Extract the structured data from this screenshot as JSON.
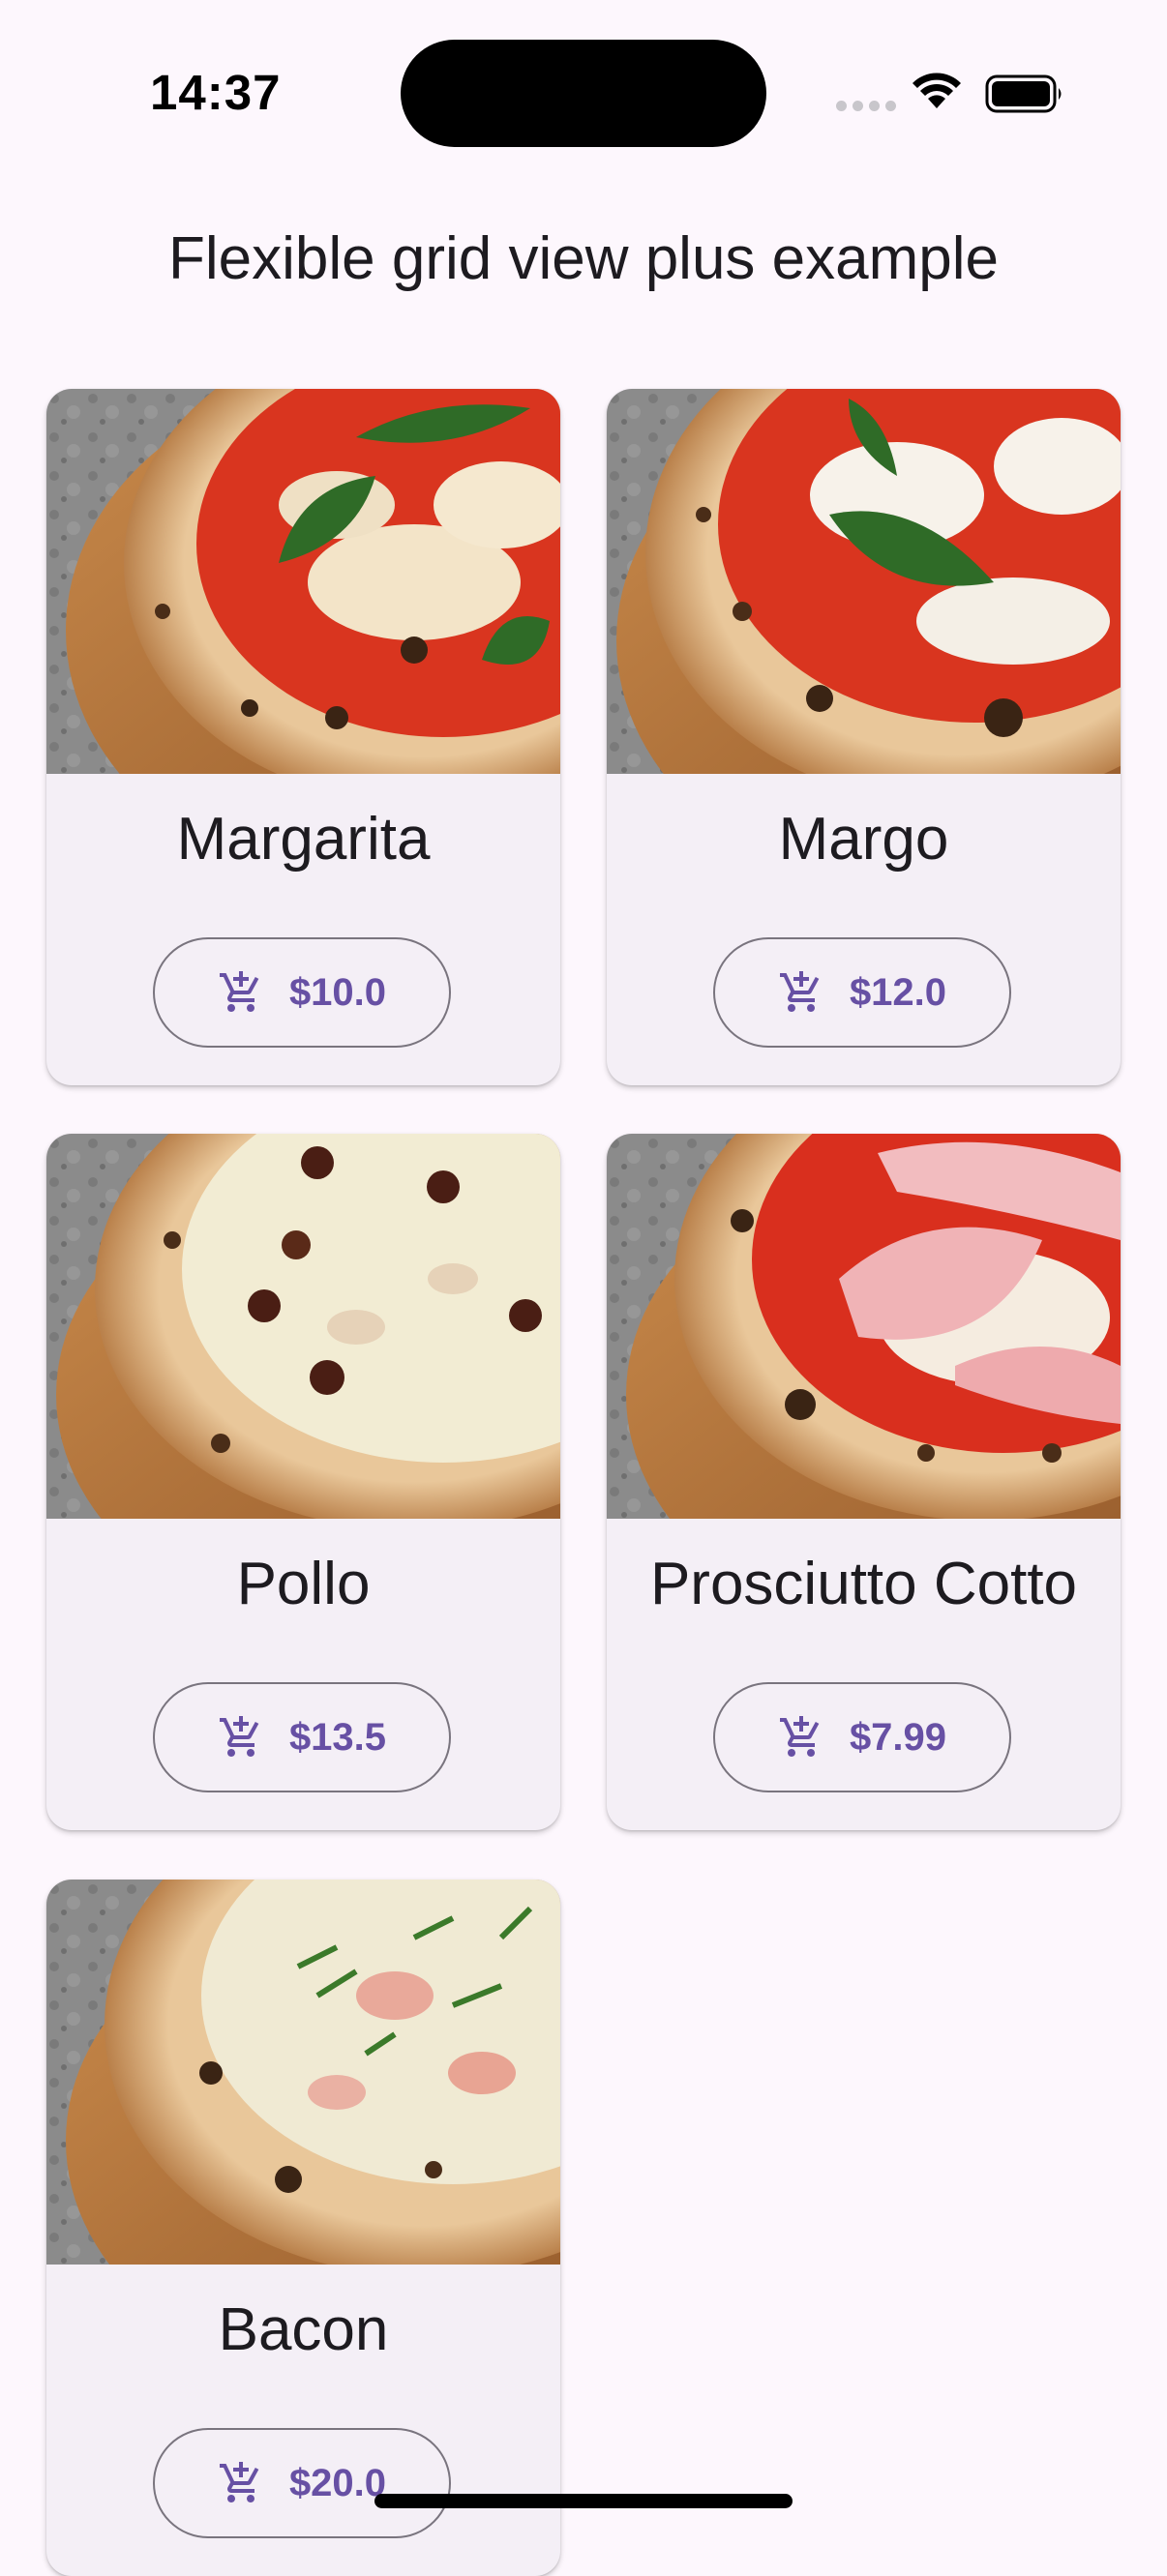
{
  "status_bar": {
    "time": "14:37"
  },
  "header": {
    "title": "Flexible grid view plus example"
  },
  "products": [
    {
      "name": "Margarita",
      "price": "$10.0"
    },
    {
      "name": "Margo",
      "price": "$12.0"
    },
    {
      "name": "Pollo",
      "price": "$13.5"
    },
    {
      "name": "Prosciutto Cotto",
      "price": "$7.99"
    },
    {
      "name": "Bacon",
      "price": "$20.0"
    }
  ],
  "colors": {
    "background": "#fdf7fd",
    "card": "#f4eff6",
    "accent": "#6750a4",
    "outline": "#79747e"
  },
  "icons": {
    "cart": "add-shopping-cart-icon"
  }
}
